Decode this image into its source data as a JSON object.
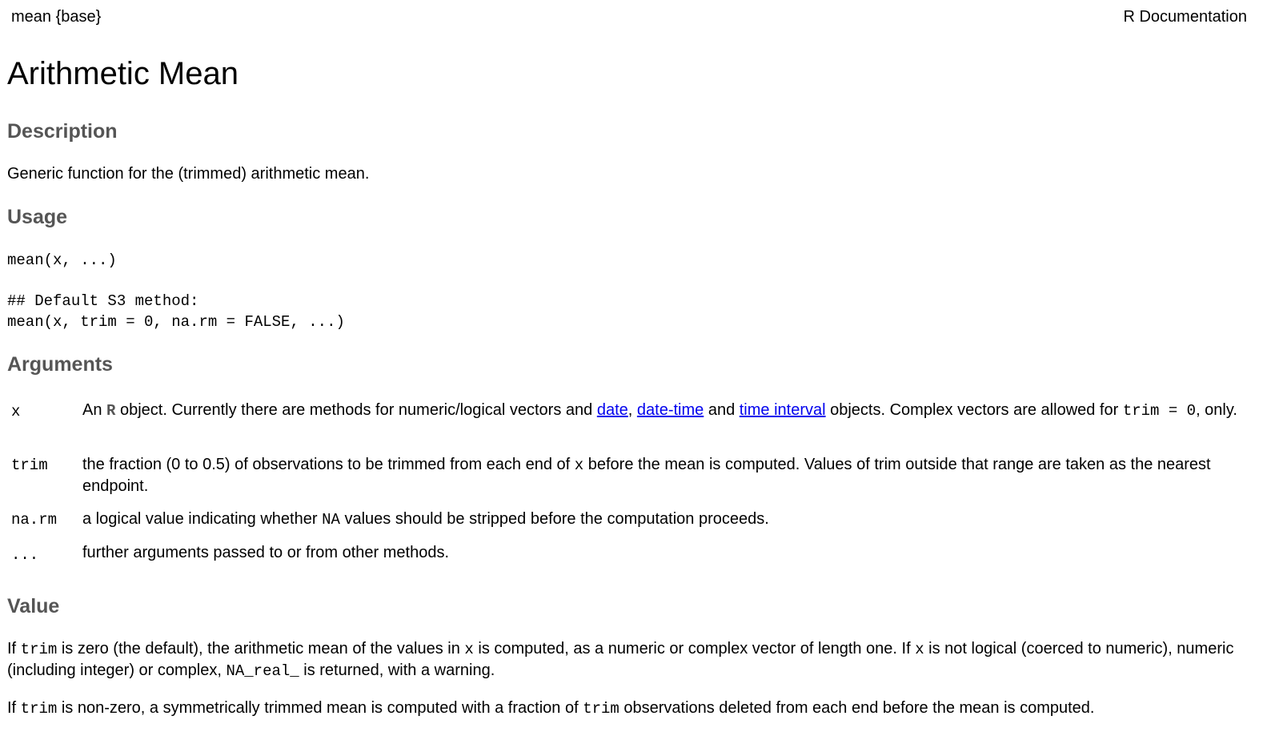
{
  "header": {
    "topic": "mean {base}",
    "source": "R Documentation"
  },
  "title": "Arithmetic Mean",
  "sections": {
    "description": {
      "heading": "Description",
      "text": "Generic function for the (trimmed) arithmetic mean."
    },
    "usage": {
      "heading": "Usage",
      "lines": [
        "mean(x, ...)",
        "## Default S3 method:",
        "mean(x, trim = 0, na.rm = FALSE, ...)"
      ]
    },
    "arguments": {
      "heading": "Arguments",
      "items": [
        {
          "name": "x",
          "parts": {
            "p1": "An ",
            "rlogo": "R",
            "p2": " object. Currently there are methods for numeric/logical vectors and ",
            "link1": "date",
            "p3": ", ",
            "link2": "date-time",
            "p4": " and ",
            "link3": "time interval",
            "p5": " objects. Complex vectors are allowed for ",
            "code1": "trim = 0",
            "p6": ", only."
          }
        },
        {
          "name": "trim",
          "parts": {
            "p1": "the fraction (0 to 0.5) of observations to be trimmed from each end of ",
            "code1": "x",
            "p2": " before the mean is computed. Values of trim outside that range are taken as the nearest endpoint."
          }
        },
        {
          "name": "na.rm",
          "parts": {
            "p1": "a logical value indicating whether ",
            "code1": "NA",
            "p2": " values should be stripped before the computation proceeds."
          }
        },
        {
          "name": "...",
          "parts": {
            "p1": "further arguments passed to or from other methods."
          }
        }
      ]
    },
    "value": {
      "heading": "Value",
      "para1": {
        "p1": "If ",
        "code1": "trim",
        "p2": " is zero (the default), the arithmetic mean of the values in ",
        "code2": "x",
        "p3": " is computed, as a numeric or complex vector of length one. If ",
        "code3": "x",
        "p4": " is not logical (coerced to numeric), numeric (including integer) or complex, ",
        "code4": "NA_real_",
        "p5": " is returned, with a warning."
      },
      "para2": {
        "p1": "If ",
        "code1": "trim",
        "p2": " is non-zero, a symmetrically trimmed mean is computed with a fraction of ",
        "code2": "trim",
        "p3": " observations deleted from each end before the mean is computed."
      }
    }
  }
}
